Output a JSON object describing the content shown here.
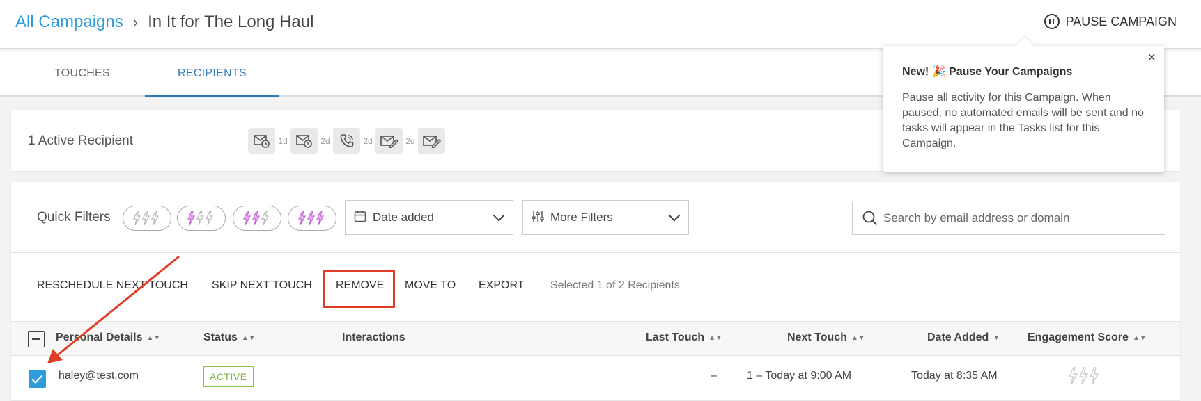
{
  "header": {
    "breadcrumb_root": "All Campaigns",
    "breadcrumb_current": "In It for The Long Haul",
    "pause_label": "PAUSE CAMPAIGN"
  },
  "tabs": [
    {
      "label": "TOUCHES"
    },
    {
      "label": "RECIPIENTS",
      "active": true
    }
  ],
  "summary": {
    "active_recipients": "1 Active Recipient",
    "touch_gaps": [
      "1d",
      "2d",
      "2d",
      "2d"
    ],
    "touch_icons": [
      "email-timer-icon",
      "email-timer-icon",
      "phone-icon",
      "email-edit-icon",
      "email-edit-icon"
    ]
  },
  "filters": {
    "quick_label": "Quick Filters",
    "date_label": "Date added",
    "more_label": "More Filters",
    "search_placeholder": "Search by email address or domain"
  },
  "actions": {
    "reschedule": "RESCHEDULE NEXT TOUCH",
    "skip": "SKIP NEXT TOUCH",
    "remove": "REMOVE",
    "move": "MOVE TO",
    "export": "EXPORT",
    "selected": "Selected 1 of 2 Recipients"
  },
  "table": {
    "headers": {
      "personal": "Personal Details",
      "status": "Status",
      "interactions": "Interactions",
      "last_touch": "Last Touch",
      "next_touch": "Next Touch",
      "date_added": "Date Added",
      "engagement": "Engagement Score"
    },
    "rows": [
      {
        "email": "haley@test.com",
        "status": "ACTIVE",
        "interactions": "",
        "last_touch": "–",
        "next_touch": "1 – Today at 9:00 AM",
        "date_added": "Today at 8:35 AM"
      }
    ]
  },
  "popover": {
    "title_prefix": "New! ",
    "title_emoji": "🎉",
    "title": " Pause Your Campaigns",
    "body": "Pause all activity for this Campaign. When paused, no automated emails will be sent and no tasks will appear in the Tasks list for this Campaign.",
    "close": "×"
  },
  "colors": {
    "accent": "#2d9cdb",
    "highlight": "#e03b24",
    "status_active": "#7cb342",
    "bolt": "#c86dd7"
  }
}
